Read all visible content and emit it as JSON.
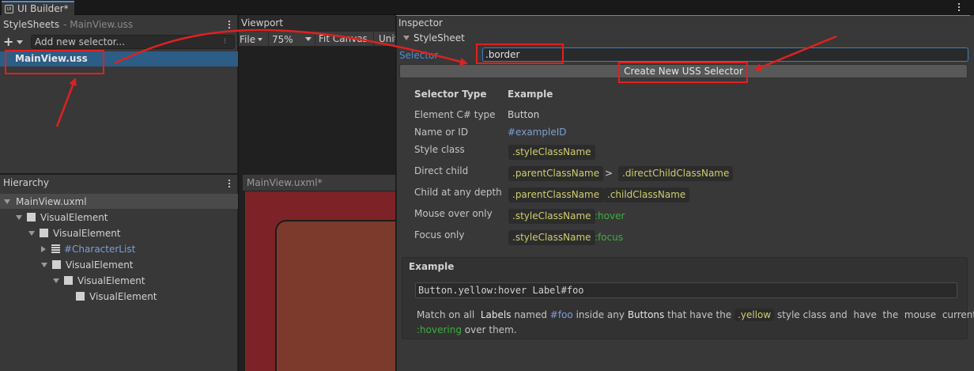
{
  "window": {
    "tab_title": "UI Builder*"
  },
  "stylesheets": {
    "title": "StyleSheets",
    "subtitle": "- MainView.uss",
    "add_selector_placeholder": "Add new selector...",
    "add_button": "+",
    "items": [
      "MainView.uss"
    ]
  },
  "hierarchy": {
    "title": "Hierarchy",
    "root": "MainView.uxml",
    "nodes": [
      "VisualElement",
      "VisualElement",
      "#CharacterList",
      "VisualElement",
      "VisualElement",
      "VisualElement"
    ]
  },
  "viewport": {
    "title": "Viewport",
    "file_menu": "File",
    "zoom": "75%",
    "fit_canvas": "Fit Canvas",
    "truncated_item": "Unit",
    "document_title": "MainView.uxml*"
  },
  "inspector": {
    "title": "Inspector",
    "section": "StyleSheet",
    "selector_label": "Selector",
    "selector_value": ".border",
    "create_button": "Create New USS Selector",
    "table": {
      "header_type": "Selector Type",
      "header_example": "Example",
      "row_element_type": "Element C# type",
      "ex_element_type": "Button",
      "row_name": "Name or ID",
      "ex_name": "#exampleID",
      "row_class": "Style class",
      "ex_class": ".styleClassName",
      "row_direct": "Direct child",
      "ex_direct_parent": ".parentClassName",
      "ex_direct_sep": ">",
      "ex_direct_child": ".directChildClassName",
      "row_depth": "Child at any depth",
      "ex_depth_parent": ".parentClassName",
      "ex_depth_child": ".childClassName",
      "row_hover": "Mouse over only",
      "ex_hover_class": ".styleClassName",
      "ex_hover_pseudo": ":hover",
      "row_focus": "Focus only",
      "ex_focus_class": ".styleClassName",
      "ex_focus_pseudo": ":focus"
    },
    "example": {
      "title": "Example",
      "code": "Button.yellow:hover Label#foo",
      "desc_1": "Match on all",
      "desc_labels": "Labels",
      "desc_2": "named",
      "desc_foo": "#foo",
      "desc_3": "inside any",
      "desc_buttons": "Buttons",
      "desc_4": "that have the",
      "desc_yellow": ".yellow",
      "desc_5": "style class and",
      "desc_6": "have",
      "desc_7": "the",
      "desc_8": "mouse",
      "desc_9": "currently",
      "desc_hovering": ":hovering",
      "desc_10": "over them."
    }
  },
  "colors": {
    "annotation": "#e02020",
    "pseudo": "#3fae3f",
    "class_tag": "#cfcd6f",
    "id_link": "#7e9fd6",
    "selected_row": "#2c5d87"
  }
}
